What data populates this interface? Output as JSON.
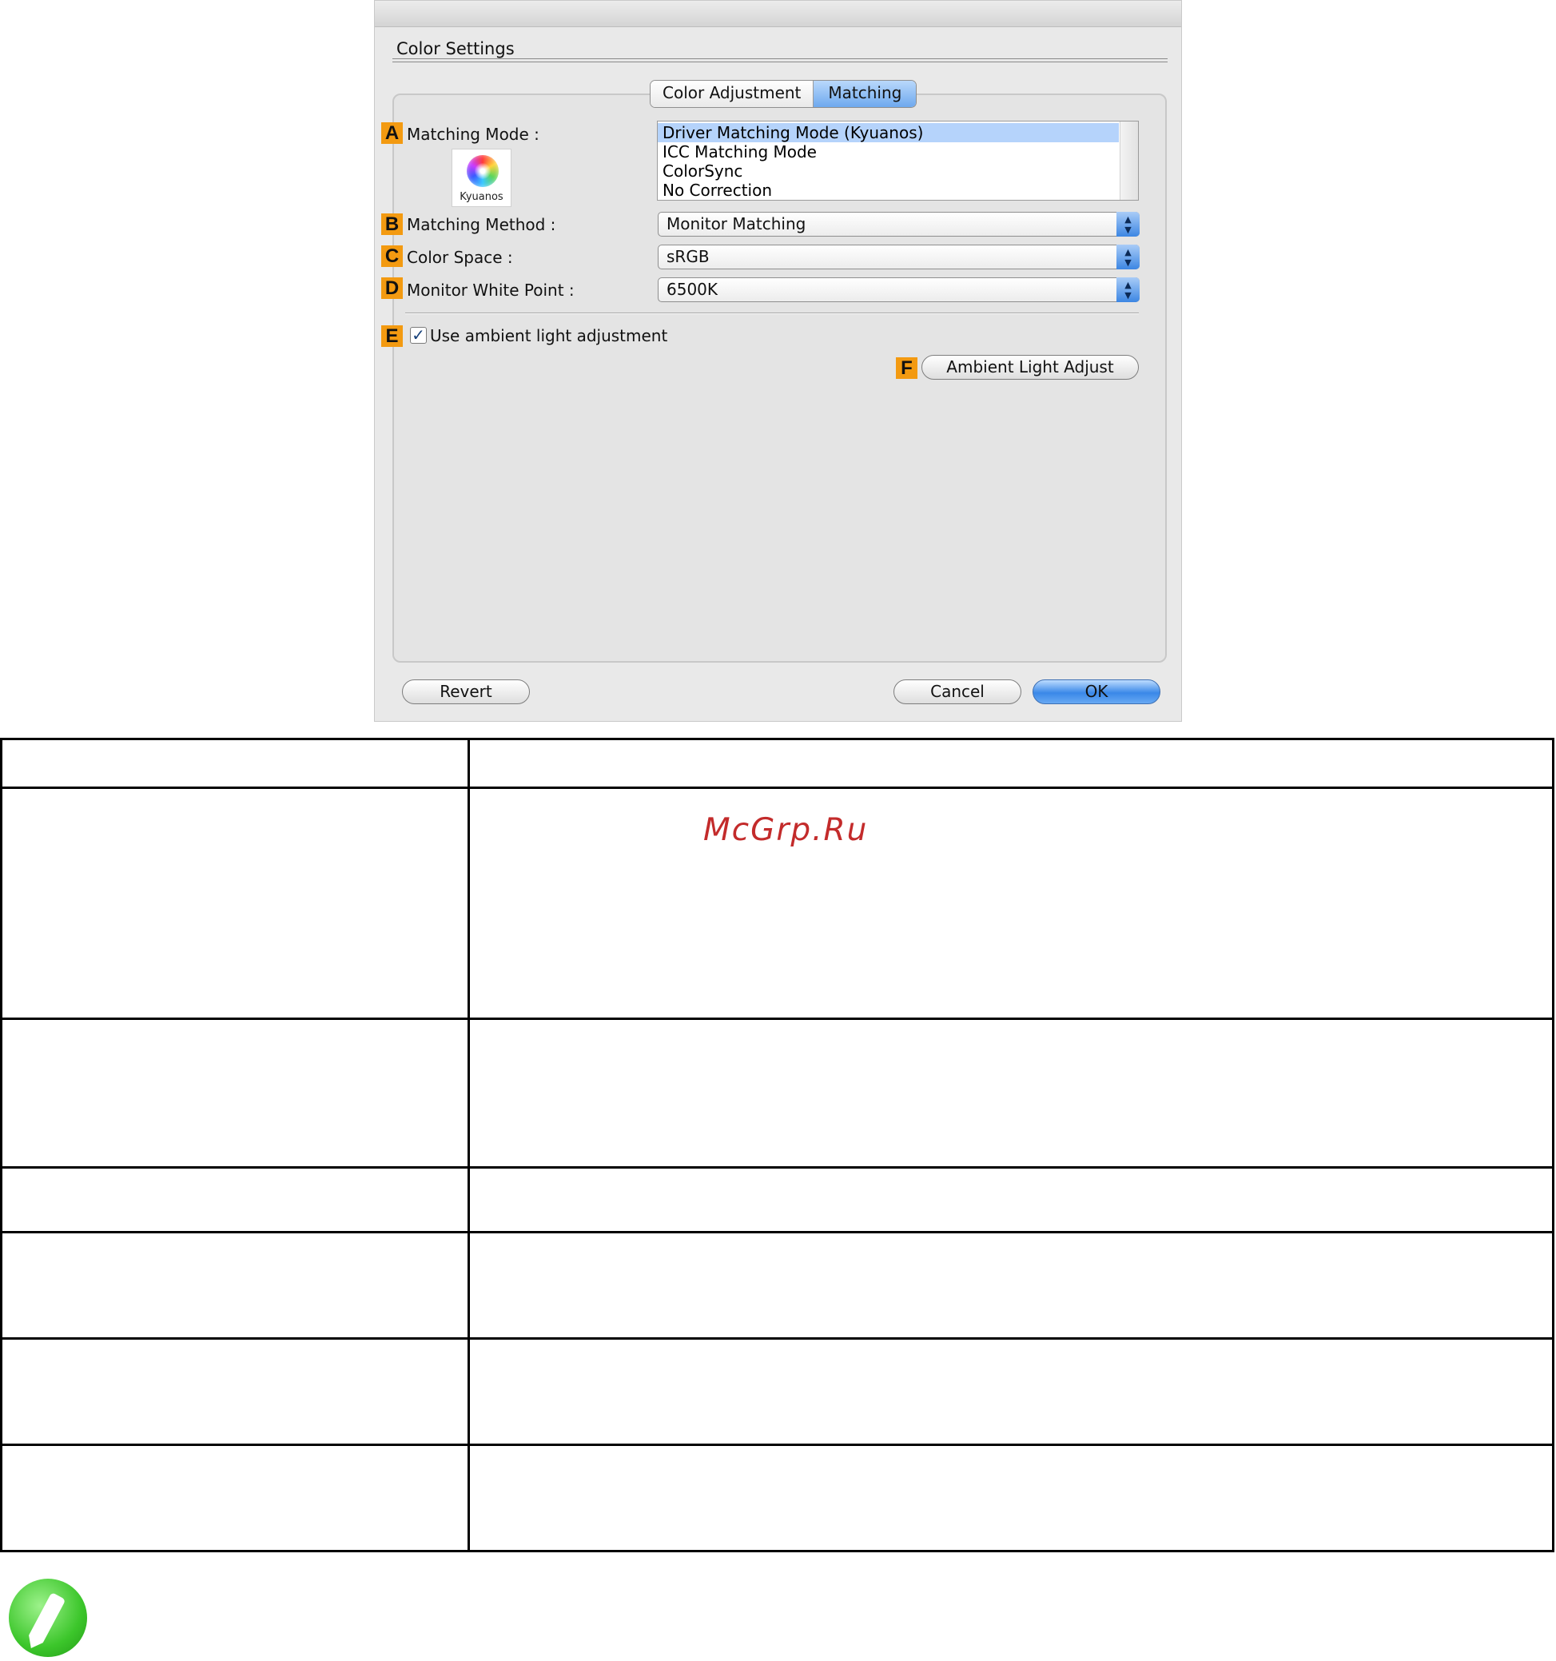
{
  "dialog": {
    "section_title": "Color Settings",
    "tabs": [
      {
        "label": "Color Adjustment",
        "active": false
      },
      {
        "label": "Matching",
        "active": true
      }
    ],
    "matching_mode": {
      "badge": "A",
      "label": "Matching Mode :",
      "logo_caption": "Kyuanos",
      "options": [
        "Driver Matching Mode (Kyuanos)",
        "ICC Matching Mode",
        "ColorSync",
        "No Correction"
      ],
      "selected": "Driver Matching Mode (Kyuanos)"
    },
    "matching_method": {
      "badge": "B",
      "label": "Matching Method :",
      "value": "Monitor Matching"
    },
    "color_space": {
      "badge": "C",
      "label": "Color Space :",
      "value": "sRGB"
    },
    "monitor_white_point": {
      "badge": "D",
      "label": "Monitor White Point :",
      "value": "6500K"
    },
    "ambient_light": {
      "badge": "E",
      "label": "Use ambient light adjustment",
      "checked": true
    },
    "ambient_light_button": {
      "badge": "F",
      "label": "Ambient Light Adjust"
    },
    "buttons": {
      "revert": "Revert",
      "cancel": "Cancel",
      "ok": "OK"
    },
    "colors": {
      "badge": "#f39a11",
      "selection": "#b5d3fb",
      "accent": "#3a88e8"
    }
  },
  "watermark": "McGrp.Ru",
  "note_icon": "pencil-note-icon"
}
